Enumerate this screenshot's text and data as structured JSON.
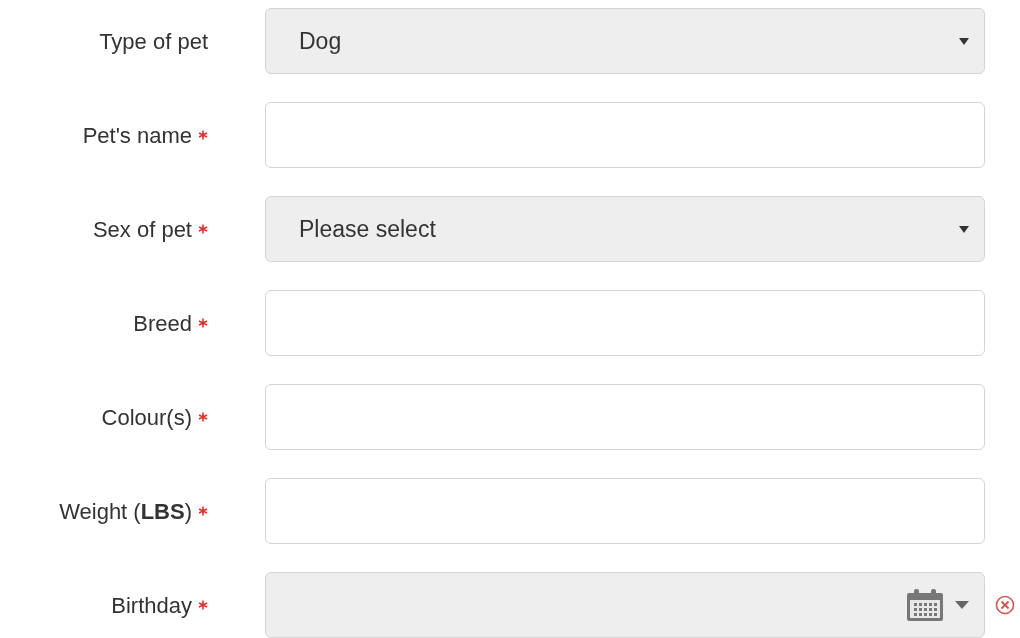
{
  "fields": [
    {
      "kind": "select",
      "label": "Type of pet",
      "required": false,
      "value": "Dog"
    },
    {
      "kind": "text",
      "label": "Pet's name",
      "required": true
    },
    {
      "kind": "select",
      "label": "Sex of pet",
      "required": true,
      "value": "Please select"
    },
    {
      "kind": "text",
      "label": "Breed",
      "required": true
    },
    {
      "kind": "text",
      "label": "Colour(s)",
      "required": true
    },
    {
      "kind": "text",
      "label": "Weight (**LBS**)",
      "required": true
    },
    {
      "kind": "date",
      "label": "Birthday",
      "required": true
    }
  ]
}
